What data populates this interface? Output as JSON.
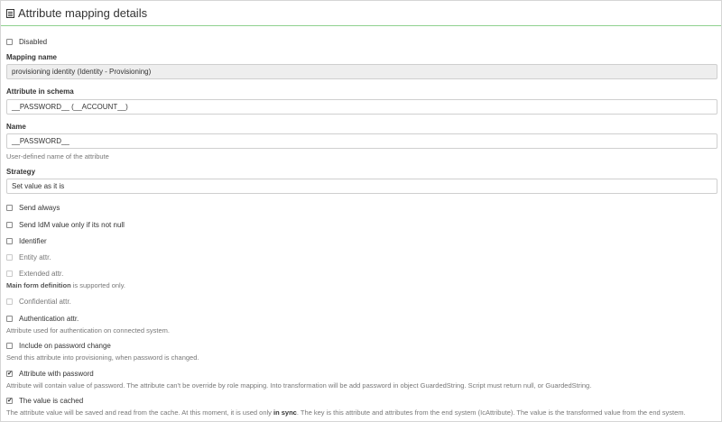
{
  "header": {
    "title": "Attribute mapping details",
    "icon": "list-icon"
  },
  "disabled_label": "Disabled",
  "mapping_name": {
    "label": "Mapping name",
    "value": "provisioning identity (Identity - Provisioning)"
  },
  "attribute_in_schema": {
    "label": "Attribute in schema",
    "value": "__PASSWORD__ (__ACCOUNT__)"
  },
  "name": {
    "label": "Name",
    "value": "__PASSWORD__",
    "help": "User-defined name of the attribute"
  },
  "strategy": {
    "label": "Strategy",
    "value": "Set value as it is"
  },
  "checkboxes": {
    "send_always": "Send always",
    "send_not_null": "Send IdM value only if its not null",
    "identifier": "Identifier",
    "entity_attr": "Entity attr.",
    "extended_attr": "Extended attr.",
    "confidential_attr": "Confidential attr.",
    "authentication_attr": "Authentication attr.",
    "include_password_change": "Include on password change",
    "attribute_with_password": "Attribute with password",
    "value_cached": "The value is cached"
  },
  "notes": {
    "main_form_bold": "Main form definition",
    "main_form_rest": " is supported only.",
    "authentication_help": "Attribute used for authentication on connected system.",
    "password_change_help": "Send this attribute into provisioning, when password is changed.",
    "password_help": "Attribute will contain value of password. The attribute can't be override by role mapping. Into transformation will be add password in object GuardedString. Script must return null, or GuardedString.",
    "cached_help_1": "The attribute value will be saved and read from the cache. At this moment, it is used only ",
    "cached_help_bold": "in sync",
    "cached_help_2": ". The key is this attribute and attributes from the end system (IcAttribute). The value is the transformed value from the end system."
  },
  "checked": {
    "attribute_with_password": true,
    "value_cached": true
  }
}
